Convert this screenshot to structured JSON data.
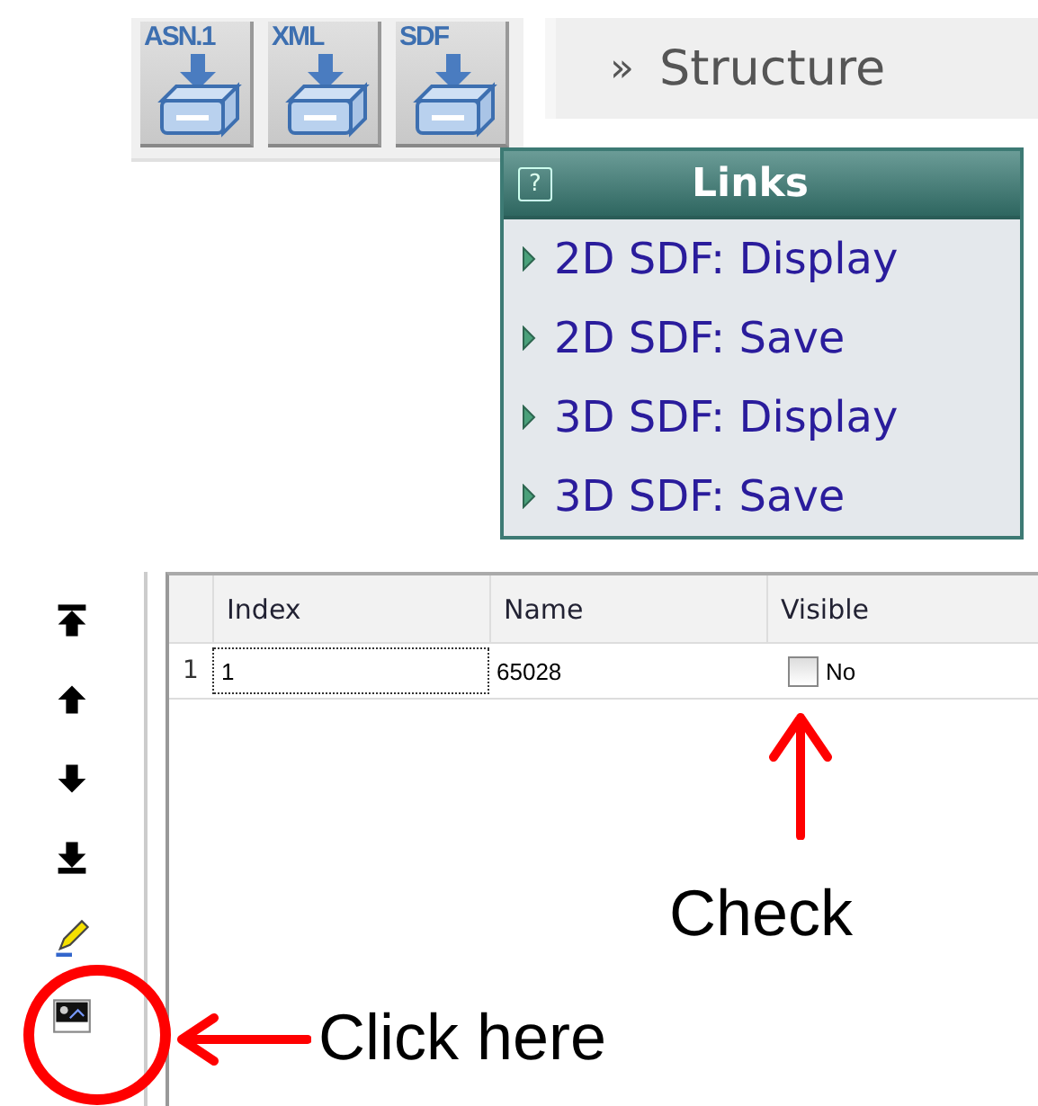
{
  "toolbar": {
    "buttons": [
      {
        "label": "ASN.1"
      },
      {
        "label": "XML"
      },
      {
        "label": "SDF"
      }
    ]
  },
  "panel_tab": {
    "marker": "»",
    "label": "Structure"
  },
  "links_popup": {
    "help": "?",
    "title": "Links",
    "items": [
      "2D SDF: Display",
      "2D SDF: Save",
      "3D SDF: Display",
      "3D SDF: Save"
    ]
  },
  "table": {
    "columns": [
      "Index",
      "Name",
      "Visible"
    ],
    "rows": [
      {
        "number": "1",
        "index": "1",
        "name": "65028",
        "visible": {
          "checked": false,
          "label": "No"
        }
      }
    ]
  },
  "annotations": [
    {
      "kind": "arrow_up",
      "text": "Check"
    },
    {
      "kind": "circle_left",
      "text": "Click here"
    }
  ]
}
